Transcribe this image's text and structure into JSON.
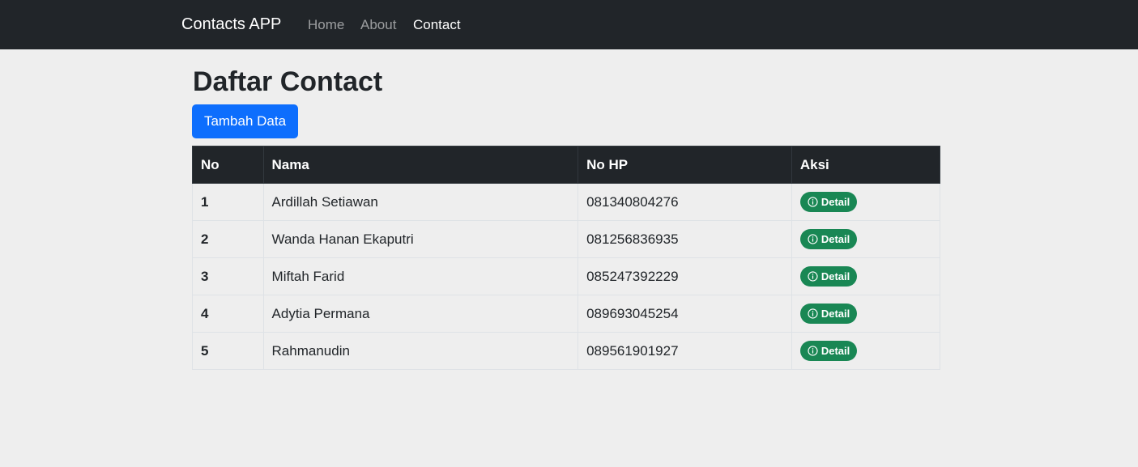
{
  "navbar": {
    "brand": "Contacts APP",
    "links": [
      {
        "label": "Home",
        "active": false
      },
      {
        "label": "About",
        "active": false
      },
      {
        "label": "Contact",
        "active": true
      }
    ]
  },
  "main": {
    "title": "Daftar Contact",
    "add_button_label": "Tambah Data",
    "table": {
      "headers": [
        "No",
        "Nama",
        "No HP",
        "Aksi"
      ],
      "rows": [
        {
          "no": "1",
          "nama": "Ardillah Setiawan",
          "hp": "081340804276",
          "action": "Detail"
        },
        {
          "no": "2",
          "nama": "Wanda Hanan Ekaputri",
          "hp": "081256836935",
          "action": "Detail"
        },
        {
          "no": "3",
          "nama": "Miftah Farid",
          "hp": "085247392229",
          "action": "Detail"
        },
        {
          "no": "4",
          "nama": "Adytia Permana",
          "hp": "089693045254",
          "action": "Detail"
        },
        {
          "no": "5",
          "nama": "Rahmanudin",
          "hp": "089561901927",
          "action": "Detail"
        }
      ]
    }
  },
  "colors": {
    "navbar_bg": "#212529",
    "primary": "#0d6efd",
    "success": "#198754",
    "page_bg": "#eeeeee"
  },
  "icons": {
    "detail": "info-circle-icon"
  }
}
